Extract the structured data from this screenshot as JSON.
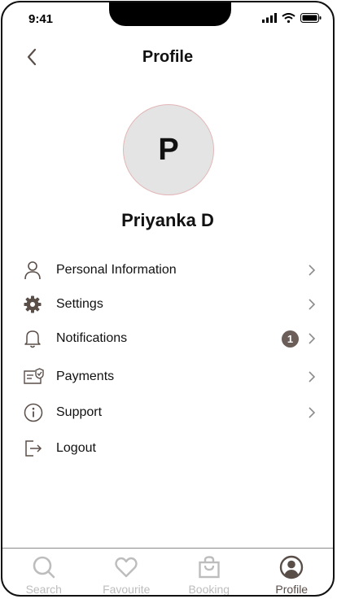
{
  "status_bar": {
    "time": "9:41"
  },
  "header": {
    "title": "Profile"
  },
  "profile": {
    "initial": "P",
    "name": "Priyanka D"
  },
  "menu": [
    {
      "label": "Personal Information",
      "icon": "user-icon"
    },
    {
      "label": "Settings",
      "icon": "gear-icon"
    },
    {
      "label": "Notifications",
      "icon": "bell-icon",
      "badge": "1"
    },
    {
      "label": "Payments",
      "icon": "payment-card-icon"
    },
    {
      "label": "Support",
      "icon": "info-icon"
    },
    {
      "label": "Logout",
      "icon": "logout-icon"
    }
  ],
  "tabs": [
    {
      "label": "Search",
      "icon": "search-icon"
    },
    {
      "label": "Favourite",
      "icon": "heart-icon"
    },
    {
      "label": "Booking",
      "icon": "shopping-bag-icon"
    },
    {
      "label": "Profile",
      "icon": "profile-icon",
      "active": true
    }
  ],
  "colors": {
    "accent": "#6b5d57",
    "inactive_tab": "#bdbdbd",
    "avatar_bg": "#e4e4e4"
  }
}
